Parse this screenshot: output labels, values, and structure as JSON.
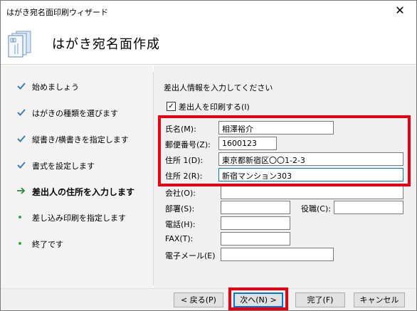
{
  "window": {
    "title": "はがき宛名面印刷ウィザード",
    "close_glyph": "✕"
  },
  "header": {
    "title": "はがき宛名面作成"
  },
  "sidebar": {
    "steps": [
      {
        "label": "始めましょう",
        "state": "done"
      },
      {
        "label": "はがきの種類を選びます",
        "state": "done"
      },
      {
        "label": "縦書き/横書きを指定します",
        "state": "done"
      },
      {
        "label": "書式を設定します",
        "state": "done"
      },
      {
        "label": "差出人の住所を入力します",
        "state": "current"
      },
      {
        "label": "差し込み印刷を指定します",
        "state": "pending"
      },
      {
        "label": "終了です",
        "state": "pending"
      }
    ]
  },
  "form": {
    "instruction": "差出人情報を入力してください",
    "print_sender": {
      "label": "差出人を印刷する(I)",
      "checked": true
    },
    "name": {
      "label": "氏名(M):",
      "value": "相澤裕介"
    },
    "postal": {
      "label": "郵便番号(Z):",
      "value": "1600123"
    },
    "address1": {
      "label": "住所 1(D):",
      "value": "東京都新宿区〇〇1-2-3"
    },
    "address2": {
      "label": "住所 2(R):",
      "value": "新宿マンション303"
    },
    "company": {
      "label": "会社(O):",
      "value": ""
    },
    "department": {
      "label": "部署(S):",
      "value": ""
    },
    "position": {
      "label": "役職(C):",
      "value": ""
    },
    "phone": {
      "label": "電話(H):",
      "value": ""
    },
    "fax": {
      "label": "FAX(T):",
      "value": ""
    },
    "email": {
      "label": "電子メール(E)",
      "value": ""
    }
  },
  "footer": {
    "back": "< 戻る(P)",
    "next": "次へ(N) >",
    "finish": "完了(F)",
    "cancel": "キャンセル"
  },
  "colors": {
    "highlight": "#e60012",
    "check": "#3c7fb1",
    "accent": "#0078d7"
  }
}
